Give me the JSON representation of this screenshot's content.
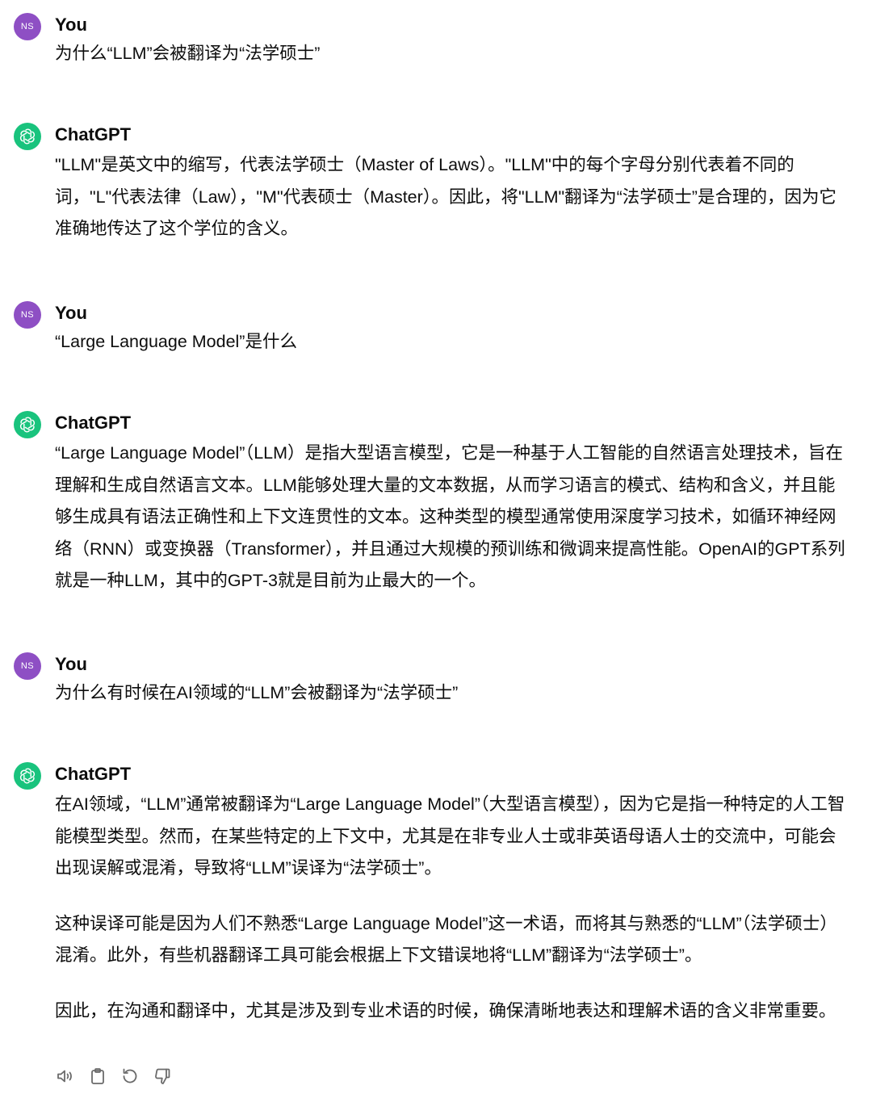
{
  "colors": {
    "user_avatar_bg": "#8e4fc4",
    "assistant_avatar_bg": "#19c37d",
    "text": "#0d0d0d",
    "icon": "#6b6b6b"
  },
  "messages": [
    {
      "author": "You",
      "avatar": "NS",
      "paragraphs": [
        "为什么“LLM”会被翻译为“法学硕士”"
      ]
    },
    {
      "author": "ChatGPT",
      "avatar_icon": "openai-logo-icon",
      "paragraphs": [
        "\"LLM\"是英文中的缩写，代表法学硕士（Master of Laws）。\"LLM\"中的每个字母分别代表着不同的词，\"L\"代表法律（Law），\"M\"代表硕士（Master）。因此，将\"LLM\"翻译为“法学硕士”是合理的，因为它准确地传达了这个学位的含义。"
      ]
    },
    {
      "author": "You",
      "avatar": "NS",
      "paragraphs": [
        "“Large Language Model”是什么"
      ]
    },
    {
      "author": "ChatGPT",
      "avatar_icon": "openai-logo-icon",
      "paragraphs": [
        "“Large Language Model”（LLM）是指大型语言模型，它是一种基于人工智能的自然语言处理技术，旨在理解和生成自然语言文本。LLM能够处理大量的文本数据，从而学习语言的模式、结构和含义，并且能够生成具有语法正确性和上下文连贯性的文本。这种类型的模型通常使用深度学习技术，如循环神经网络（RNN）或变换器（Transformer），并且通过大规模的预训练和微调来提高性能。OpenAI的GPT系列就是一种LLM，其中的GPT-3就是目前为止最大的一个。"
      ]
    },
    {
      "author": "You",
      "avatar": "NS",
      "paragraphs": [
        "为什么有时候在AI领域的“LLM”会被翻译为“法学硕士”"
      ]
    },
    {
      "author": "ChatGPT",
      "avatar_icon": "openai-logo-icon",
      "paragraphs": [
        "在AI领域，“LLM”通常被翻译为“Large Language Model”（大型语言模型），因为它是指一种特定的人工智能模型类型。然而，在某些特定的上下文中，尤其是在非专业人士或非英语母语人士的交流中，可能会出现误解或混淆，导致将“LLM”误译为“法学硕士”。",
        "这种误译可能是因为人们不熟悉“Large Language Model”这一术语，而将其与熟悉的“LLM”（法学硕士）混淆。此外，有些机器翻译工具可能会根据上下文错误地将“LLM”翻译为“法学硕士”。",
        "因此，在沟通和翻译中，尤其是涉及到专业术语的时候，确保清晰地表达和理解术语的含义非常重要。"
      ]
    }
  ],
  "actions": [
    "speaker-icon",
    "clipboard-icon",
    "regenerate-icon",
    "thumbs-down-icon"
  ]
}
